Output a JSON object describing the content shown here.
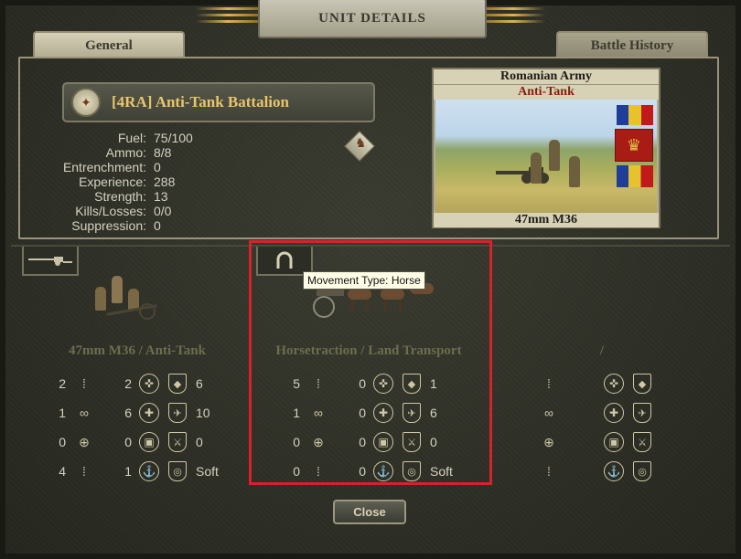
{
  "dialog": {
    "title": "UNIT DETAILS"
  },
  "tabs": {
    "general": "General",
    "battle_history": "Battle History"
  },
  "unit": {
    "name": "[4RA] Anti-Tank Battalion",
    "stats": [
      {
        "label": "Fuel:",
        "value": "75/100"
      },
      {
        "label": "Ammo:",
        "value": "8/8"
      },
      {
        "label": "Entrenchment:",
        "value": "0"
      },
      {
        "label": "Experience:",
        "value": "288"
      },
      {
        "label": "Strength:",
        "value": "13"
      },
      {
        "label": "Kills/Losses:",
        "value": "0/0"
      },
      {
        "label": "Suppression:",
        "value": "0"
      }
    ]
  },
  "card": {
    "army": "Romanian Army",
    "class": "Anti-Tank",
    "equipment": "47mm M36"
  },
  "tooltip": {
    "text": "Movement Type: Horse"
  },
  "slots": [
    {
      "title": "47mm M36 / Anti-Tank",
      "rows": [
        [
          "2",
          "2",
          "6"
        ],
        [
          "1",
          "6",
          "10"
        ],
        [
          "0",
          "0",
          "0"
        ],
        [
          "4",
          "1",
          "Soft"
        ]
      ]
    },
    {
      "title": "Horsetraction / Land Transport",
      "rows": [
        [
          "5",
          "0",
          "1"
        ],
        [
          "1",
          "0",
          "6"
        ],
        [
          "0",
          "0",
          "0"
        ],
        [
          "0",
          "0",
          "Soft"
        ]
      ]
    },
    {
      "title": "/",
      "rows": [
        [
          "",
          "",
          ""
        ],
        [
          "",
          "",
          ""
        ],
        [
          "",
          "",
          ""
        ],
        [
          "",
          "",
          ""
        ]
      ]
    }
  ],
  "icons": {
    "rows": [
      [
        "footprints-icon",
        "infantry-target-icon",
        "armor-shield-icon"
      ],
      [
        "binoculars-icon",
        "soft-target-icon",
        "air-defense-shield-icon"
      ],
      [
        "crosshair-icon",
        "hard-target-icon",
        "close-defense-shield-icon"
      ],
      [
        "ammo-icon",
        "naval-target-icon",
        "target-type-icon"
      ]
    ]
  },
  "buttons": {
    "close": "Close"
  },
  "colors": {
    "highlight": "#d4232a",
    "accent_gold": "#e8c66a",
    "class_red": "#8a1e10"
  }
}
